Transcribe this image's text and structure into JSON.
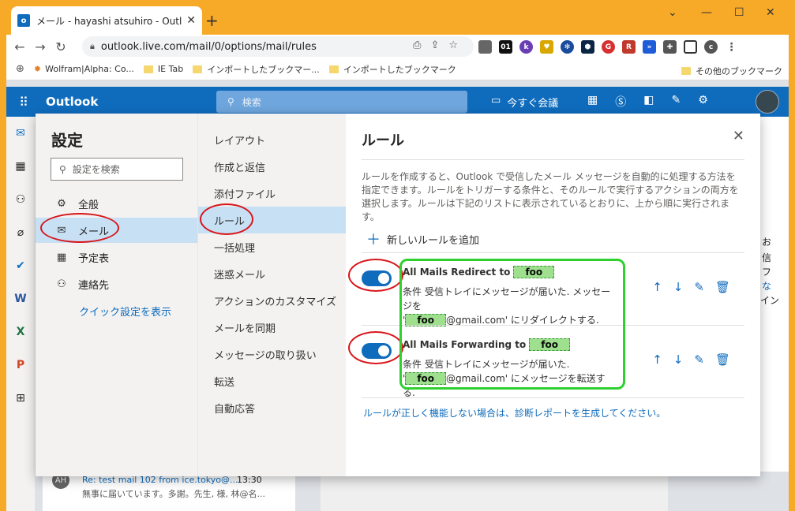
{
  "browser": {
    "tab_title": "メール - hayashi atsuhiro - Outlook",
    "tab_close": "✕",
    "new_tab": "+",
    "url": "outlook.live.com/mail/0/options/mail/rules",
    "bookmarks": [
      "Wolfram|Alpha: Co...",
      "IE Tab",
      "インポートしたブックマー...",
      "インポートしたブックマーク"
    ],
    "bookmarks_other": "その他のブックマーク"
  },
  "outlook": {
    "brand": "Outlook",
    "search_placeholder": "検索",
    "meet_now": "今すぐ会議"
  },
  "settings": {
    "title": "設定",
    "search_placeholder": "設定を検索",
    "categories": [
      "全般",
      "メール",
      "予定表",
      "連絡先"
    ],
    "quick_settings": "クイック設定を表示"
  },
  "mail_menu": [
    "レイアウト",
    "作成と返信",
    "添付ファイル",
    "ルール",
    "一括処理",
    "迷惑メール",
    "アクションのカスタマイズ",
    "メールを同期",
    "メッセージの取り扱い",
    "転送",
    "自動応答"
  ],
  "rules": {
    "title": "ルール",
    "description": "ルールを作成すると、Outlook で受信したメール メッセージを自動的に処理する方法を指定できます。ルールをトリガーする条件と、そのルールで実行するアクションの両方を選択します。ルールは下記のリストに表示されているとおりに、上から順に実行されます。",
    "add_rule": "新しいルールを追加",
    "items": [
      {
        "name": "All Mails Redirect to",
        "name_tag": "foo",
        "desc_line1": "条件 受信トレイにメッセージが届いた. メッセージを",
        "desc_pre": "'",
        "desc_tag": "foo",
        "desc_post": "@gmail.com' にリダイレクトする."
      },
      {
        "name": "All Mails Forwarding to",
        "name_tag": "foo",
        "desc_line1": "条件 受信トレイにメッセージが届いた.",
        "desc_pre": "'",
        "desc_tag": "foo",
        "desc_post": "@gmail.com' にメッセージを転送する."
      }
    ],
    "footer_link": "ルールが正しく機能しない場合は、診断レポートを生成してください。"
  },
  "background_mail": {
    "initials": "AH",
    "subject": "Re: test mail 102 from ice.tokyo@...",
    "time": "13:30",
    "preview": "無事に届いています。多謝。先生, 様, 林@名..."
  },
  "right_partial": [
    "お",
    "信",
    "フ",
    "な",
    "イン"
  ],
  "colors": {
    "accent": "#0f6cbd",
    "selected": "#c7e0f4",
    "annotation_red": "#d9151a",
    "annotation_green": "#2fd02f",
    "frame_orange": "#f7a928"
  }
}
